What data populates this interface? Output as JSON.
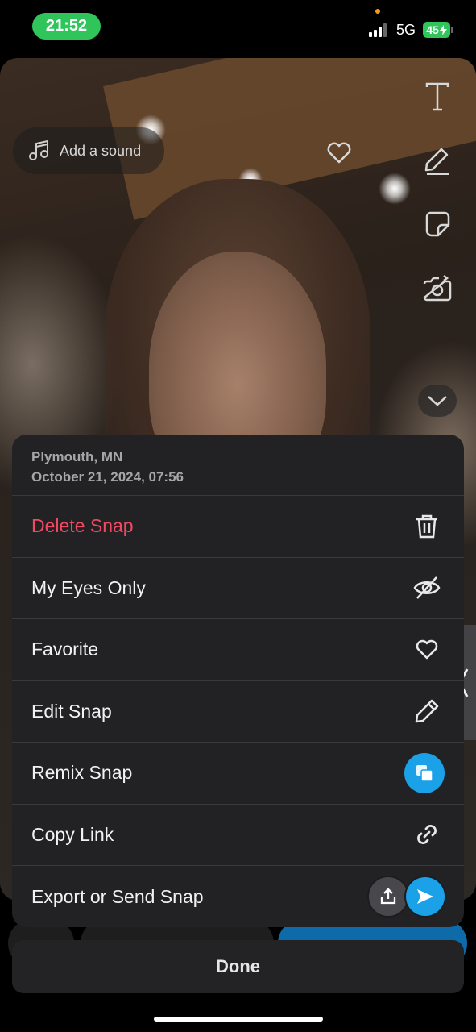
{
  "status_bar": {
    "time": "21:52",
    "network": "5G",
    "battery": "45"
  },
  "editor": {
    "sound_label": "Add a sound",
    "tools": [
      "text-icon",
      "pencil-icon",
      "sticker-icon",
      "camera-flip-icon",
      "chevron-down-icon"
    ]
  },
  "menu": {
    "location": "Plymouth, MN",
    "datetime": "October 21, 2024, 07:56",
    "items": [
      {
        "label": "Delete Snap",
        "icon": "trash-icon",
        "danger": true
      },
      {
        "label": "My Eyes Only",
        "icon": "eye-off-icon"
      },
      {
        "label": "Favorite",
        "icon": "heart-icon"
      },
      {
        "label": "Edit Snap",
        "icon": "pencil-icon"
      },
      {
        "label": "Remix Snap",
        "icon": "remix-icon"
      },
      {
        "label": "Copy Link",
        "icon": "link-icon"
      },
      {
        "label": "Export or Send Snap",
        "icon": "export-send-icon"
      }
    ]
  },
  "done_label": "Done",
  "colors": {
    "danger": "#f04a63",
    "accent_blue": "#1aa1e8",
    "time_pill": "#2fc55a",
    "sheet_bg": "#222224"
  }
}
